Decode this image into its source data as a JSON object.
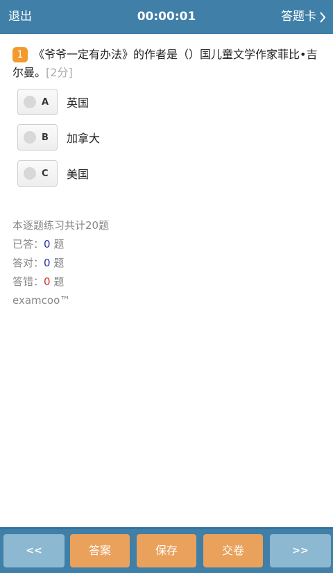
{
  "header": {
    "exit_label": "退出",
    "timer": "00:00:01",
    "card_label": "答题卡"
  },
  "question": {
    "number": "1",
    "text": "《爷爷一定有办法》的作者是（）国儿童文学作家菲比•吉尔曼。",
    "score": "[2分]"
  },
  "options": [
    {
      "letter": "A",
      "text": "英国"
    },
    {
      "letter": "B",
      "text": "加拿大"
    },
    {
      "letter": "C",
      "text": "美国"
    }
  ],
  "stats": {
    "total": "本逐题练习共计20题",
    "answered_label": "已答：",
    "answered": "0",
    "correct_label": "答对：",
    "correct": "0",
    "wrong_label": "答错：",
    "wrong": "0",
    "unit": "题",
    "brand": "examcoo™"
  },
  "footer": {
    "prev": "<<",
    "answer": "答案",
    "save": "保存",
    "submit": "交卷",
    "next": ">>"
  },
  "colors": {
    "bar": "#3f7fa8",
    "accent": "#f39a2e",
    "action_button": "#e9a15c",
    "nav_button": "#8db8d1"
  }
}
